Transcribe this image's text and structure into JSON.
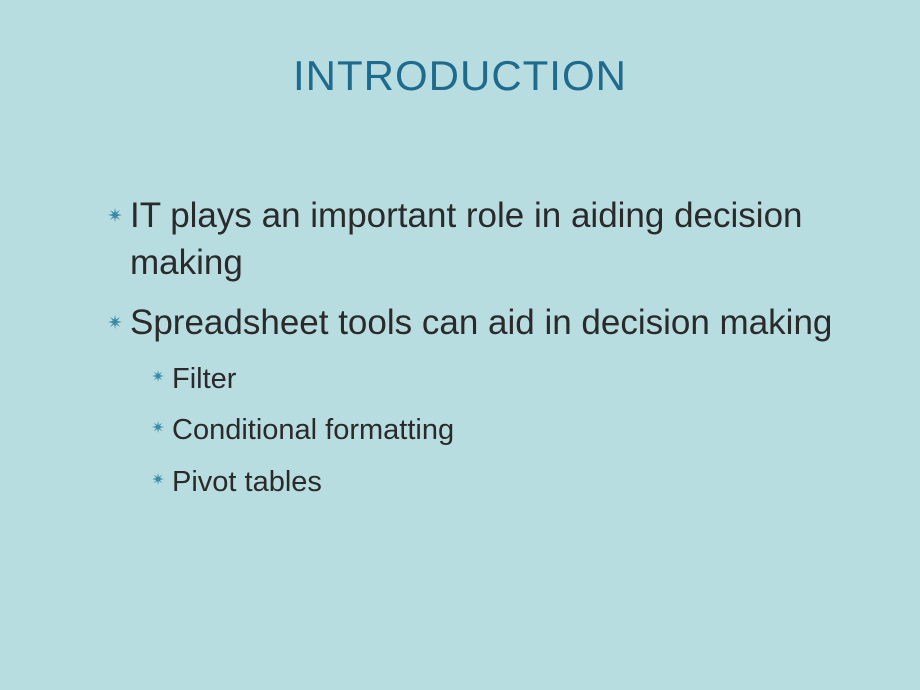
{
  "slide": {
    "title": "INTRODUCTION",
    "bullets": [
      {
        "level": 1,
        "text": "IT plays an important role in aiding decision making"
      },
      {
        "level": 1,
        "text": "Spreadsheet tools can aid in decision making"
      },
      {
        "level": 2,
        "text": "Filter"
      },
      {
        "level": 2,
        "text": "Conditional formatting"
      },
      {
        "level": 2,
        "text": "Pivot tables"
      }
    ]
  }
}
